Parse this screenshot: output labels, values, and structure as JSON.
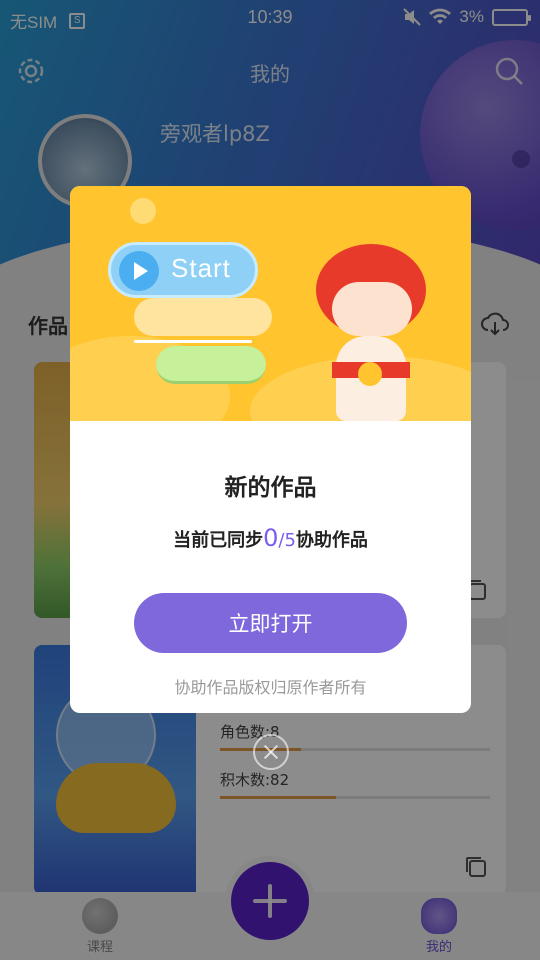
{
  "status_bar": {
    "carrier": "无SIM",
    "time": "10:39",
    "battery": "3%"
  },
  "header": {
    "title": "我的",
    "username": "旁观者lp8Z"
  },
  "works": {
    "section_title": "作品",
    "items": [
      {
        "role_label": "角色数:8",
        "role_fraction": 0.3,
        "block_label": "积木数:82",
        "block_fraction": 0.43
      }
    ]
  },
  "dialog": {
    "banner_start_text": "Start",
    "title": "新的作品",
    "sync_prefix": "当前已同步",
    "sync_count": "0",
    "sync_total": "/5",
    "sync_suffix": "协助作品",
    "open_button": "立即打开",
    "footnote": "协助作品版权归原作者所有"
  },
  "bottom_nav": {
    "course_label": "课程",
    "mine_label": "我的"
  },
  "colors": {
    "accent": "#7f67dc",
    "fab": "#5a22c8",
    "banner": "#ffc42e"
  }
}
